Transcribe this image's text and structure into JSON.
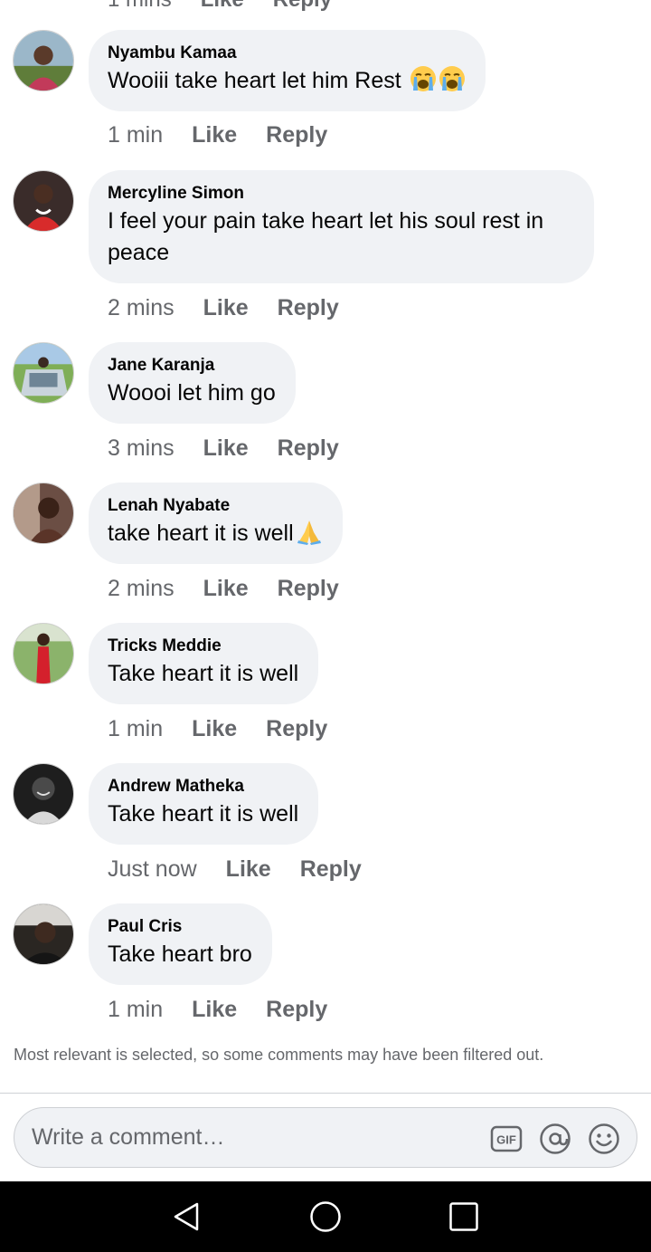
{
  "top_partial": {
    "time": "1 mins",
    "like": "Like",
    "reply": "Reply"
  },
  "comments": [
    {
      "author": "Nyambu Kamaa",
      "text": "Wooiii take heart let him Rest",
      "emojis": [
        "crying-face",
        "crying-face"
      ],
      "time": "1 min",
      "like": "Like",
      "reply": "Reply"
    },
    {
      "author": "Mercyline Simon",
      "text": "I feel your pain take heart let his soul rest in peace",
      "time": "2 mins",
      "like": "Like",
      "reply": "Reply"
    },
    {
      "author": "Jane Karanja",
      "text": "Woooi let him go",
      "time": "3 mins",
      "like": "Like",
      "reply": "Reply"
    },
    {
      "author": "Lenah Nyabate",
      "text": "take heart it is well",
      "emojis": [
        "folded-hands"
      ],
      "time": "2 mins",
      "like": "Like",
      "reply": "Reply"
    },
    {
      "author": "Tricks Meddie",
      "text": "Take heart it is well",
      "time": "1 min",
      "like": "Like",
      "reply": "Reply"
    },
    {
      "author": "Andrew Matheka",
      "text": "Take heart it is well",
      "time": "Just now",
      "like": "Like",
      "reply": "Reply"
    },
    {
      "author": "Paul Cris",
      "text": "Take heart bro",
      "time": "1 min",
      "like": "Like",
      "reply": "Reply"
    }
  ],
  "filter_note": "Most relevant is selected, so some comments may have been filtered out.",
  "composer": {
    "placeholder": "Write a comment…",
    "icons": [
      "gif-icon",
      "at-mention-icon",
      "emoji-icon"
    ]
  },
  "system_nav": {
    "icons": [
      "back-icon",
      "home-icon",
      "recents-icon"
    ]
  },
  "colors": {
    "bubble": "#f0f2f5",
    "secondary_text": "#65676b",
    "primary_text": "#050505",
    "nav_bar": "#000000"
  }
}
